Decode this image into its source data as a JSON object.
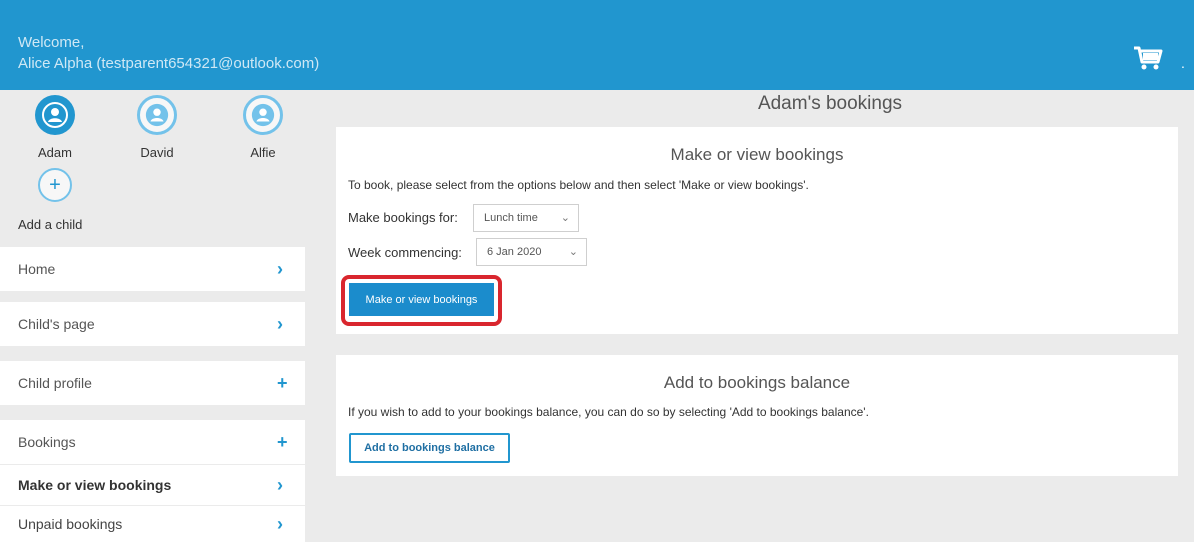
{
  "header": {
    "welcome_line1": "Welcome,",
    "welcome_line2": "Alice Alpha (testparent654321@outlook.com)",
    "cart_icon": "cart-icon",
    "menu_dot": "."
  },
  "children": [
    {
      "name": "Adam",
      "active": true
    },
    {
      "name": "David",
      "active": false
    },
    {
      "name": "Alfie",
      "active": false
    }
  ],
  "add_child": {
    "label": "Add a child",
    "icon": "+"
  },
  "menu": [
    {
      "label": "Home",
      "icon": "›"
    },
    {
      "label": "Child's page",
      "icon": "›"
    },
    {
      "label": "Child profile",
      "icon": "+"
    },
    {
      "label": "Bookings",
      "icon": "+"
    },
    {
      "label": "Make or view bookings",
      "icon": "›"
    },
    {
      "label": "Unpaid bookings",
      "icon": "›"
    }
  ],
  "main": {
    "title": "Adam's bookings",
    "bookings_card": {
      "title": "Make or view bookings",
      "instructions": "To book, please select from the options below and then select 'Make or view bookings'.",
      "make_for_label": "Make bookings for:",
      "make_for_value": "Lunch time",
      "week_label": "Week commencing:",
      "week_value": "6 Jan 2020",
      "button_label": "Make or view bookings"
    },
    "balance_card": {
      "title": "Add to bookings balance",
      "instructions": "If you wish to add to your bookings balance, you can do so by selecting 'Add to bookings balance'.",
      "button_label": "Add to bookings balance"
    }
  },
  "colors": {
    "header": "#2196cf",
    "accent": "#1b8ccc",
    "highlight": "#d9262e"
  }
}
